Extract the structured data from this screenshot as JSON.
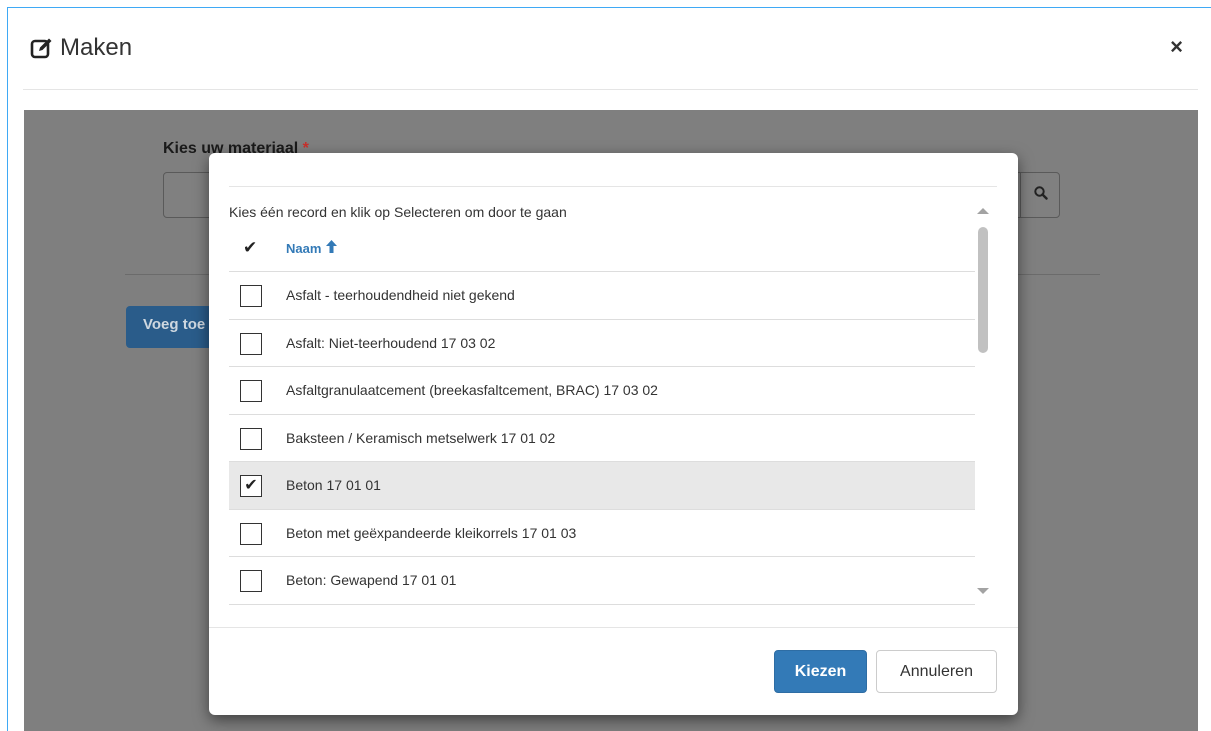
{
  "window": {
    "title": "Maken",
    "close_symbol": "×"
  },
  "background_form": {
    "label": "Kies uw materiaal",
    "required_marker": "*",
    "add_button_label": "Voeg toe"
  },
  "picker": {
    "instruction": "Kies één record en klik op Selecteren om door te gaan",
    "select_column_icon": "checkmark-icon",
    "name_column_label": "Naam",
    "sort_direction": "ascending",
    "rows": [
      {
        "label": "Asfalt - teerhoudendheid niet gekend",
        "checked": false
      },
      {
        "label": "Asfalt: Niet-teerhoudend 17 03 02",
        "checked": false
      },
      {
        "label": "Asfaltgranulaatcement (breekasfaltcement, BRAC) 17 03 02",
        "checked": false
      },
      {
        "label": "Baksteen / Keramisch metselwerk 17 01 02",
        "checked": false
      },
      {
        "label": "Beton 17 01 01",
        "checked": true
      },
      {
        "label": "Beton met geëxpandeerde kleikorrels 17 01 03",
        "checked": false
      },
      {
        "label": "Beton: Gewapend 17 01 01",
        "checked": false
      }
    ],
    "confirm_label": "Kiezen",
    "cancel_label": "Annuleren"
  },
  "colors": {
    "primary": "#337ab7",
    "frame_accent": "#3fa9f5",
    "overlay": "#7f7f7f",
    "selected_row": "#e8e8e8"
  }
}
